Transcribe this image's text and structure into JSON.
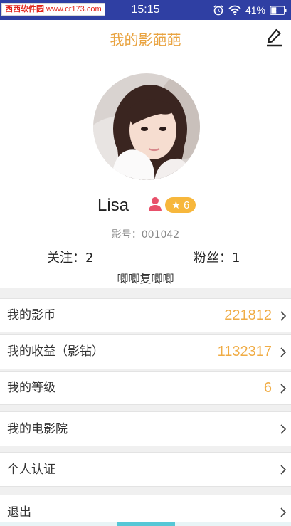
{
  "status_bar": {
    "watermark_site": "西西软件园",
    "watermark_url": "www.cr173.com",
    "time": "15:15",
    "battery_percent": "41%",
    "battery_level": 0.41,
    "icons": [
      "alarm-icon",
      "wifi-icon",
      "battery-icon"
    ]
  },
  "header": {
    "title": "我的影葩葩",
    "edit_icon": "edit-icon"
  },
  "profile": {
    "name": "Lisa",
    "gender_icon": "female-user-icon",
    "level": "6",
    "id_label": "影号：001042",
    "following": "关注：2",
    "followers": "粉丝：1",
    "bio": "唧唧复唧唧"
  },
  "menu": {
    "items": [
      {
        "label": "我的影币",
        "value": "221812"
      },
      {
        "label": "我的收益（影钻）",
        "value": "1132317"
      },
      {
        "label": "我的等级",
        "value": "6"
      },
      {
        "label": "我的电影院",
        "value": ""
      },
      {
        "label": "个人认证",
        "value": ""
      },
      {
        "label": "退出",
        "value": ""
      }
    ]
  },
  "colors": {
    "status_bar": "#2f3fa3",
    "accent": "#e9a340",
    "value": "#f0ac45",
    "badge": "#f7b73c",
    "female_icon": "#e8506a",
    "divider": "#f0f0f0"
  }
}
